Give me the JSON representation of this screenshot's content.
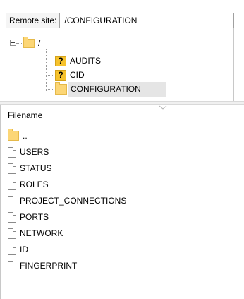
{
  "remote_site": {
    "label": "Remote site:",
    "path": "/CONFIGURATION"
  },
  "tree": {
    "root": {
      "label": "/",
      "icon": "folder-icon"
    },
    "children": [
      {
        "label": "AUDITS",
        "icon": "question-mark-folder-icon"
      },
      {
        "label": "CID",
        "icon": "question-mark-folder-icon"
      },
      {
        "label": "CONFIGURATION",
        "icon": "folder-icon",
        "selected": true
      }
    ]
  },
  "file_list": {
    "column_header": "Filename",
    "parent_entry": "..",
    "files": [
      "USERS",
      "STATUS",
      "ROLES",
      "PROJECT_CONNECTIONS",
      "PORTS",
      "NETWORK",
      "ID",
      "FINGERPRINT"
    ]
  },
  "colors": {
    "folder": "#fcd676",
    "unknown_folder": "#f6c22d",
    "selection": "#e5e5e5",
    "border": "#a0a0a0"
  }
}
